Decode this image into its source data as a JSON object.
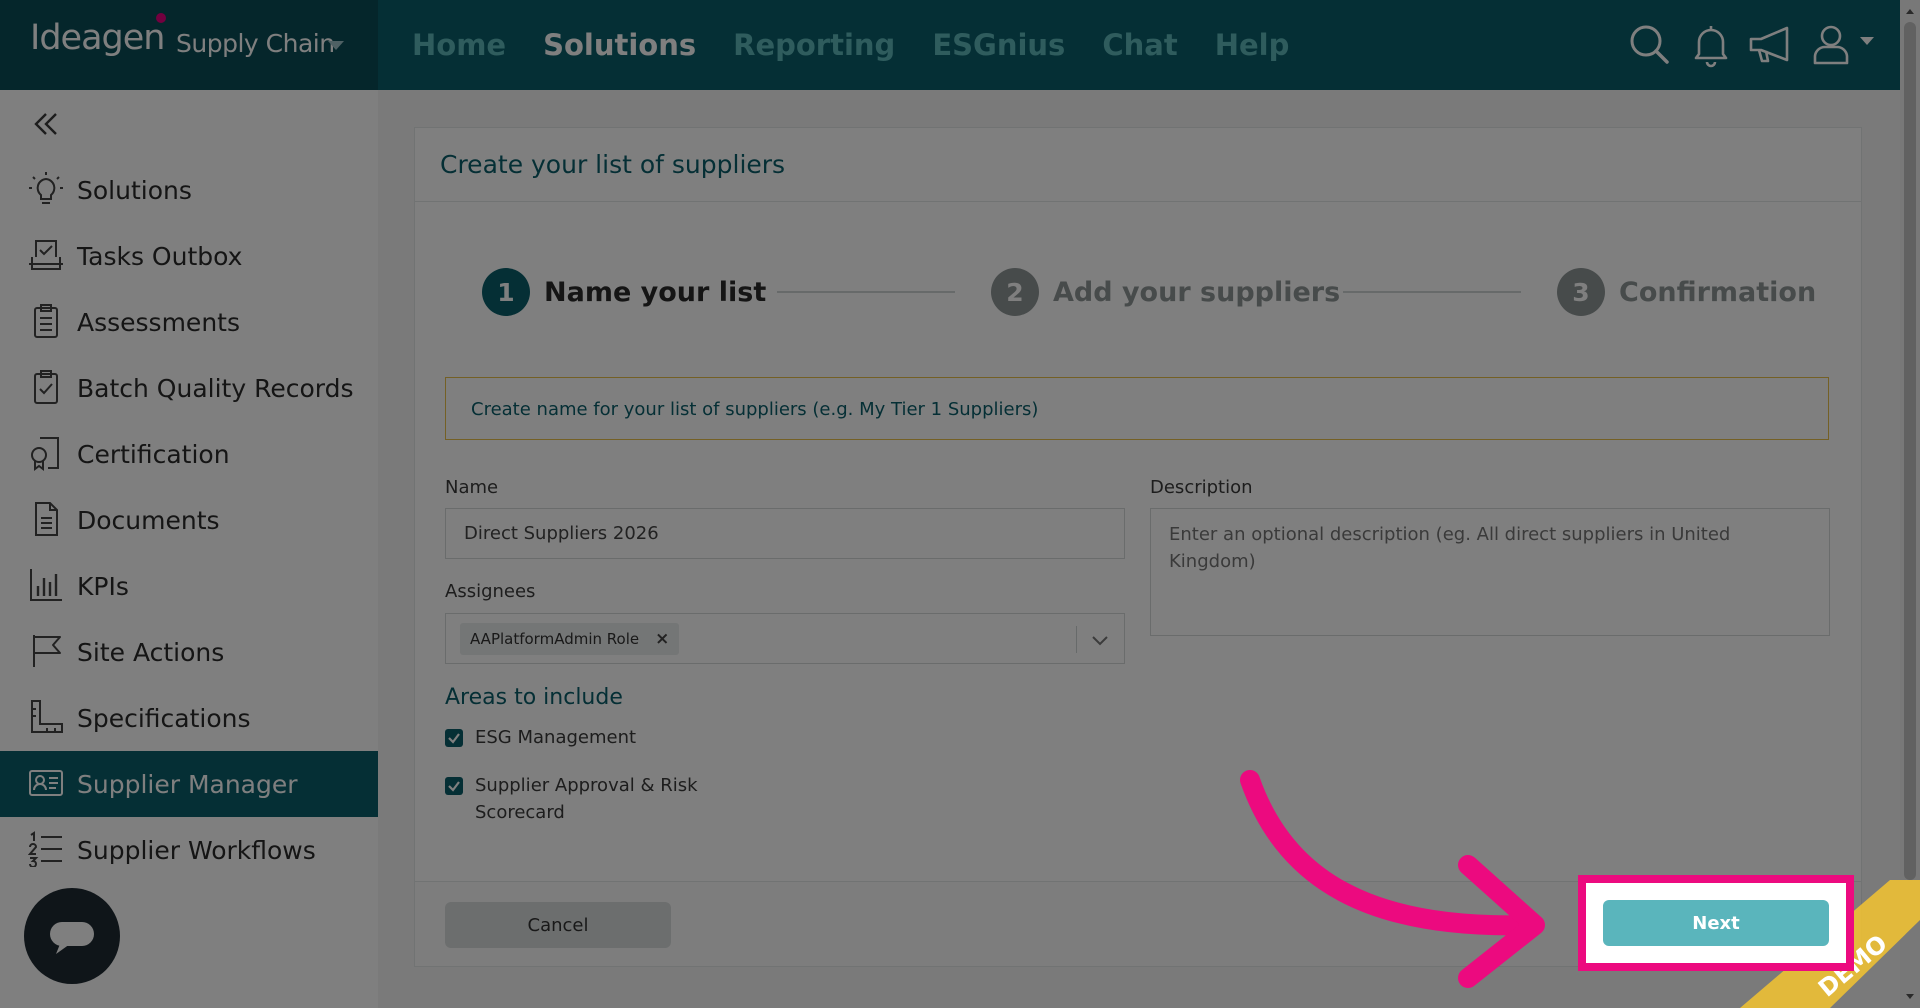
{
  "brand": {
    "logo": "Ideagen",
    "product": "Supply Chain"
  },
  "nav": [
    {
      "label": "Home",
      "active": false
    },
    {
      "label": "Solutions",
      "active": true
    },
    {
      "label": "Reporting",
      "active": false
    },
    {
      "label": "ESGnius",
      "active": false
    },
    {
      "label": "Chat",
      "active": false
    },
    {
      "label": "Help",
      "active": false
    }
  ],
  "top_icons": [
    "search-icon",
    "bell-icon",
    "megaphone-icon",
    "user-icon"
  ],
  "sidebar": {
    "items": [
      {
        "label": "Solutions",
        "icon": "lightbulb-icon"
      },
      {
        "label": "Tasks Outbox",
        "icon": "outbox-icon"
      },
      {
        "label": "Assessments",
        "icon": "clipboard-list-icon"
      },
      {
        "label": "Batch Quality Records",
        "icon": "clipboard-check-icon"
      },
      {
        "label": "Certification",
        "icon": "certificate-icon"
      },
      {
        "label": "Documents",
        "icon": "document-icon"
      },
      {
        "label": "KPIs",
        "icon": "bar-chart-icon"
      },
      {
        "label": "Site Actions",
        "icon": "flag-icon"
      },
      {
        "label": "Specifications",
        "icon": "ruler-icon"
      },
      {
        "label": "Supplier Manager",
        "icon": "id-card-icon",
        "active": true
      },
      {
        "label": "Supplier Workflows",
        "icon": "numbered-list-icon"
      }
    ]
  },
  "panel": {
    "title": "Create your list of suppliers",
    "steps": [
      {
        "num": "1",
        "label": "Name your list",
        "state": "active"
      },
      {
        "num": "2",
        "label": "Add your suppliers",
        "state": "pending"
      },
      {
        "num": "3",
        "label": "Confirmation",
        "state": "pending"
      }
    ],
    "hint": "Create name for your list of suppliers (e.g. My Tier 1 Suppliers)",
    "name_label": "Name",
    "name_value": "Direct Suppliers 2026",
    "description_label": "Description",
    "description_placeholder": "Enter an optional description (eg. All direct suppliers in United Kingdom)",
    "assignees_label": "Assignees",
    "assignee_tag": "AAPlatformAdmin Role",
    "assignee_remove": "×",
    "areas_title": "Areas to include",
    "areas": [
      {
        "label_line1": "ESG Management",
        "label_line2": "",
        "checked": true
      },
      {
        "label_line1": "Supplier Approval & Risk",
        "label_line2": "Scorecard",
        "checked": true
      }
    ],
    "cancel_label": "Cancel",
    "next_label": "Next"
  },
  "watermark": "DEMO",
  "colors": {
    "brand_dark": "#0a4d57",
    "brand": "#0b5f6b",
    "nav_inactive": "#5fb8bb",
    "next_button": "#5ab5bc",
    "highlight": "#ec0a7f",
    "hint_border": "#e8c14a"
  }
}
